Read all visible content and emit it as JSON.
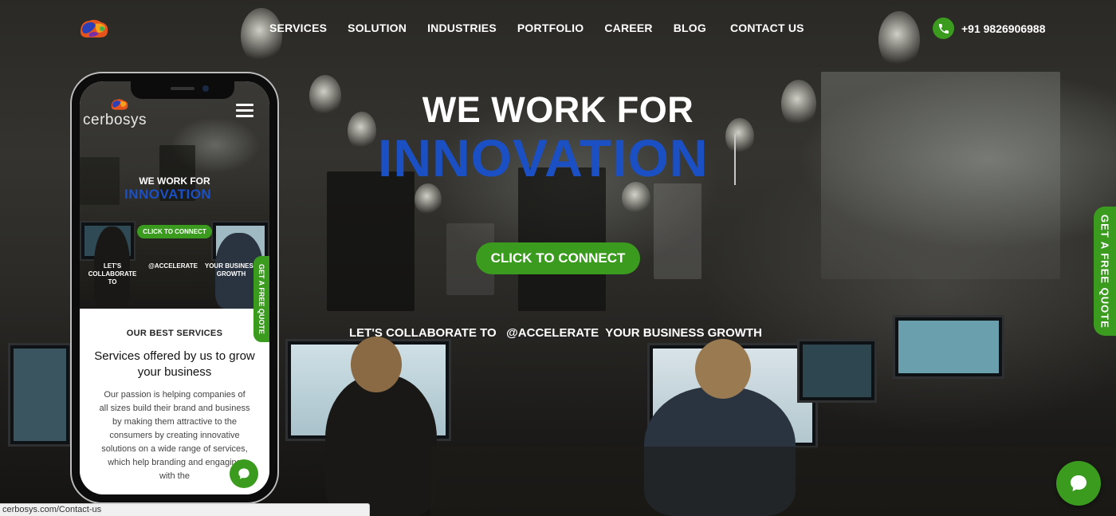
{
  "nav": {
    "items": [
      "SERVICES",
      "SOLUTION",
      "INDUSTRIES",
      "PORTFOLIO",
      "CAREER",
      "BLOG",
      "CONTACT US"
    ],
    "phone": "+91 9826906988"
  },
  "hero": {
    "title": "WE WORK FOR",
    "highlight": "INNOVATION",
    "cta": "CLICK TO CONNECT",
    "tagline": "LET'S COLLABORATE TO   @ACCELERATE  YOUR BUSINESS GROWTH"
  },
  "quote_tab": "GET A FREE QUOTE",
  "status_url": "cerbosys.com/Contact-us",
  "mobile": {
    "logo": "cerbosys",
    "title": "WE WORK FOR",
    "highlight": "INNOVATION",
    "cta": "CLICK TO CONNECT",
    "tag_left": "LET'S\nCOLLABORATE TO",
    "tag_mid": "@ACCELERATE",
    "tag_right": "YOUR BUSINESS\nGROWTH",
    "quote": "GET A FREE QUOTE",
    "eyebrow": "OUR BEST SERVICES",
    "heading": "Services offered by us to grow your business",
    "body": "Our passion is helping companies of all sizes build their brand and business by making them attractive to the consumers by creating innovative solutions on a wide range of services, which help branding and engaging with the"
  },
  "colors": {
    "accent_green": "#3a9b1f",
    "accent_blue": "#1b4fc4"
  },
  "icons": [
    "brand-logo-icon",
    "phone-icon",
    "chat-icon",
    "menu-icon"
  ]
}
